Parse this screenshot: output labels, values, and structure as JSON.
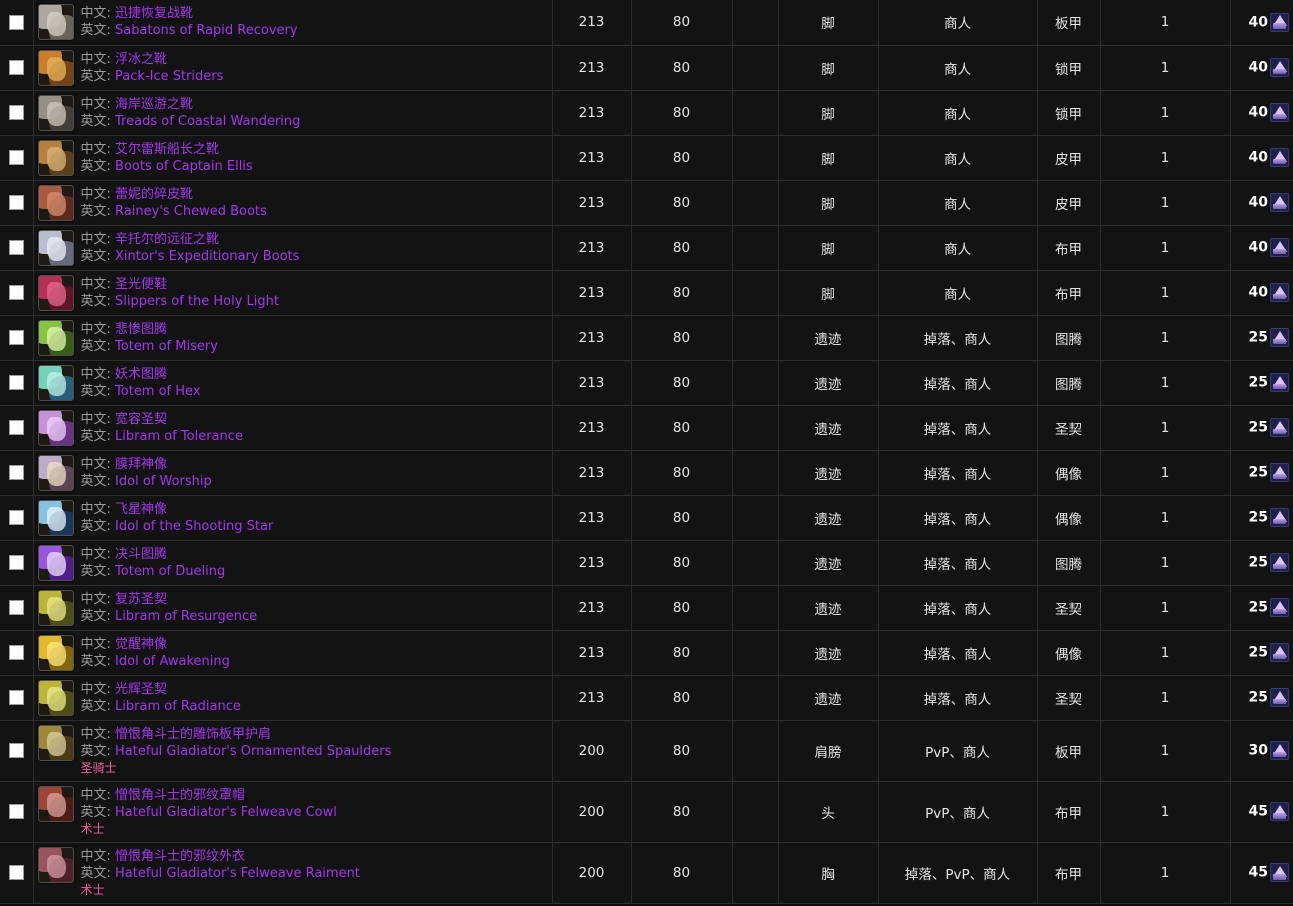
{
  "table": {
    "labels": {
      "cn": "中文:",
      "en": "英文:"
    },
    "colors": {
      "epic": "#a335ee",
      "class_text": "#f15ea0",
      "label": "#9b9b9b"
    },
    "currency_icon": "emblem-of-triumph-icon",
    "rows": [
      {
        "icon": "sabatons-icon",
        "icon_colors": [
          "#b9b4ac",
          "#7d776c",
          "#d6d2c8"
        ],
        "name_cn": "迅捷恢复战靴",
        "name_en": "Sabatons of Rapid Recovery",
        "class": "",
        "ilvl": "213",
        "req_level": "80",
        "blank": "",
        "slot": "脚",
        "source": "商人",
        "armor": "板甲",
        "qty": "1",
        "cost": "40"
      },
      {
        "icon": "pack-ice-striders-icon",
        "icon_colors": [
          "#d9872c",
          "#8a4f16",
          "#e8b45c"
        ],
        "name_cn": "浮冰之靴",
        "name_en": "Pack-Ice Striders",
        "class": "",
        "ilvl": "213",
        "req_level": "80",
        "blank": "",
        "slot": "脚",
        "source": "商人",
        "armor": "锁甲",
        "qty": "1",
        "cost": "40"
      },
      {
        "icon": "treads-coastal-icon",
        "icon_colors": [
          "#9e9a90",
          "#4b4941",
          "#cfcabd"
        ],
        "name_cn": "海岸巡游之靴",
        "name_en": "Treads of Coastal Wandering",
        "class": "",
        "ilvl": "213",
        "req_level": "80",
        "blank": "",
        "slot": "脚",
        "source": "商人",
        "armor": "锁甲",
        "qty": "1",
        "cost": "40"
      },
      {
        "icon": "boots-captain-ellis-icon",
        "icon_colors": [
          "#c08a46",
          "#6b4a1e",
          "#e0b577"
        ],
        "name_cn": "艾尔雷斯船长之靴",
        "name_en": "Boots of Captain Ellis",
        "class": "",
        "ilvl": "213",
        "req_level": "80",
        "blank": "",
        "slot": "脚",
        "source": "商人",
        "armor": "皮甲",
        "qty": "1",
        "cost": "40"
      },
      {
        "icon": "raineys-chewed-boots-icon",
        "icon_colors": [
          "#b45f48",
          "#6d2f20",
          "#d88f6d"
        ],
        "name_cn": "蕾妮的碎皮靴",
        "name_en": "Rainey's Chewed Boots",
        "class": "",
        "ilvl": "213",
        "req_level": "80",
        "blank": "",
        "slot": "脚",
        "source": "商人",
        "armor": "皮甲",
        "qty": "1",
        "cost": "40"
      },
      {
        "icon": "xintors-expeditionary-boots-icon",
        "icon_colors": [
          "#c9cbe0",
          "#7a7d99",
          "#eef0fa"
        ],
        "name_cn": "辛托尔的远征之靴",
        "name_en": "Xintor's Expeditionary Boots",
        "class": "",
        "ilvl": "213",
        "req_level": "80",
        "blank": "",
        "slot": "脚",
        "source": "商人",
        "armor": "布甲",
        "qty": "1",
        "cost": "40"
      },
      {
        "icon": "slippers-holy-light-icon",
        "icon_colors": [
          "#c2315c",
          "#6e1330",
          "#e86a8f"
        ],
        "name_cn": "圣光便鞋",
        "name_en": "Slippers of the Holy Light",
        "class": "",
        "ilvl": "213",
        "req_level": "80",
        "blank": "",
        "slot": "脚",
        "source": "商人",
        "armor": "布甲",
        "qty": "1",
        "cost": "40"
      },
      {
        "icon": "totem-of-misery-icon",
        "icon_colors": [
          "#8fd14a",
          "#3f6d1c",
          "#e5f7b0"
        ],
        "name_cn": "悲惨图腾",
        "name_en": "Totem of Misery",
        "class": "",
        "ilvl": "213",
        "req_level": "80",
        "blank": "",
        "slot": "遗迹",
        "source": "掉落、商人",
        "armor": "图腾",
        "qty": "1",
        "cost": "25"
      },
      {
        "icon": "totem-of-hex-icon",
        "icon_colors": [
          "#7fe0c8",
          "#2f6f94",
          "#bff4e6"
        ],
        "name_cn": "妖术图腾",
        "name_en": "Totem of Hex",
        "class": "",
        "ilvl": "213",
        "req_level": "80",
        "blank": "",
        "slot": "遗迹",
        "source": "掉落、商人",
        "armor": "图腾",
        "qty": "1",
        "cost": "25"
      },
      {
        "icon": "libram-of-tolerance-icon",
        "icon_colors": [
          "#d49ce8",
          "#7b3a9e",
          "#f3d2fb"
        ],
        "name_cn": "宽容圣契",
        "name_en": "Libram of Tolerance",
        "class": "",
        "ilvl": "213",
        "req_level": "80",
        "blank": "",
        "slot": "遗迹",
        "source": "掉落、商人",
        "armor": "圣契",
        "qty": "1",
        "cost": "25"
      },
      {
        "icon": "idol-of-worship-icon",
        "icon_colors": [
          "#cbb9d8",
          "#6a5068",
          "#efe0c0"
        ],
        "name_cn": "膜拜神像",
        "name_en": "Idol of Worship",
        "class": "",
        "ilvl": "213",
        "req_level": "80",
        "blank": "",
        "slot": "遗迹",
        "source": "掉落、商人",
        "armor": "偶像",
        "qty": "1",
        "cost": "25"
      },
      {
        "icon": "idol-shooting-star-icon",
        "icon_colors": [
          "#8fd0ef",
          "#1d3f6b",
          "#eaf6ff"
        ],
        "name_cn": "飞星神像",
        "name_en": "Idol of the Shooting Star",
        "class": "",
        "ilvl": "213",
        "req_level": "80",
        "blank": "",
        "slot": "遗迹",
        "source": "掉落、商人",
        "armor": "偶像",
        "qty": "1",
        "cost": "25"
      },
      {
        "icon": "totem-of-dueling-icon",
        "icon_colors": [
          "#a45bf0",
          "#5c1ea8",
          "#f0e2ff"
        ],
        "name_cn": "决斗图腾",
        "name_en": "Totem of Dueling",
        "class": "",
        "ilvl": "213",
        "req_level": "80",
        "blank": "",
        "slot": "遗迹",
        "source": "掉落、商人",
        "armor": "图腾",
        "qty": "1",
        "cost": "25"
      },
      {
        "icon": "libram-of-resurgence-icon",
        "icon_colors": [
          "#c9c13c",
          "#5c5a18",
          "#eee98a"
        ],
        "name_cn": "复苏圣契",
        "name_en": "Libram of Resurgence",
        "class": "",
        "ilvl": "213",
        "req_level": "80",
        "blank": "",
        "slot": "遗迹",
        "source": "掉落、商人",
        "armor": "圣契",
        "qty": "1",
        "cost": "25"
      },
      {
        "icon": "idol-of-awakening-icon",
        "icon_colors": [
          "#f0c92e",
          "#9c7a08",
          "#ffe780"
        ],
        "name_cn": "觉醒神像",
        "name_en": "Idol of Awakening",
        "class": "",
        "ilvl": "213",
        "req_level": "80",
        "blank": "",
        "slot": "遗迹",
        "source": "掉落、商人",
        "armor": "偶像",
        "qty": "1",
        "cost": "25"
      },
      {
        "icon": "libram-of-radiance-icon",
        "icon_colors": [
          "#c9c13c",
          "#5c5a18",
          "#eee98a"
        ],
        "name_cn": "光辉圣契",
        "name_en": "Libram of Radiance",
        "class": "",
        "ilvl": "213",
        "req_level": "80",
        "blank": "",
        "slot": "遗迹",
        "source": "掉落、商人",
        "armor": "圣契",
        "qty": "1",
        "cost": "25"
      },
      {
        "icon": "hateful-ornamented-spaulders-icon",
        "icon_colors": [
          "#a9913f",
          "#55441a",
          "#ded0a0"
        ],
        "name_cn": "憎恨角斗士的雕饰板甲护肩",
        "name_en": "Hateful Gladiator's Ornamented Spaulders",
        "class": "圣骑士",
        "ilvl": "200",
        "req_level": "80",
        "blank": "",
        "slot": "肩膀",
        "source": "PvP、商人",
        "armor": "板甲",
        "qty": "1",
        "cost": "30"
      },
      {
        "icon": "hateful-felweave-cowl-icon",
        "icon_colors": [
          "#a8483a",
          "#5b1c16",
          "#d9a79c"
        ],
        "name_cn": "憎恨角斗士的邪纹罩帽",
        "name_en": "Hateful Gladiator's Felweave Cowl",
        "class": "术士",
        "ilvl": "200",
        "req_level": "80",
        "blank": "",
        "slot": "头",
        "source": "PvP、商人",
        "armor": "布甲",
        "qty": "1",
        "cost": "45"
      },
      {
        "icon": "hateful-felweave-raiment-icon",
        "icon_colors": [
          "#a35a66",
          "#5a2430",
          "#d79aa6"
        ],
        "name_cn": "憎恨角斗士的邪纹外衣",
        "name_en": "Hateful Gladiator's Felweave Raiment",
        "class": "术士",
        "ilvl": "200",
        "req_level": "80",
        "blank": "",
        "slot": "胸",
        "source": "掉落、PvP、商人",
        "armor": "布甲",
        "qty": "1",
        "cost": "45"
      }
    ]
  }
}
